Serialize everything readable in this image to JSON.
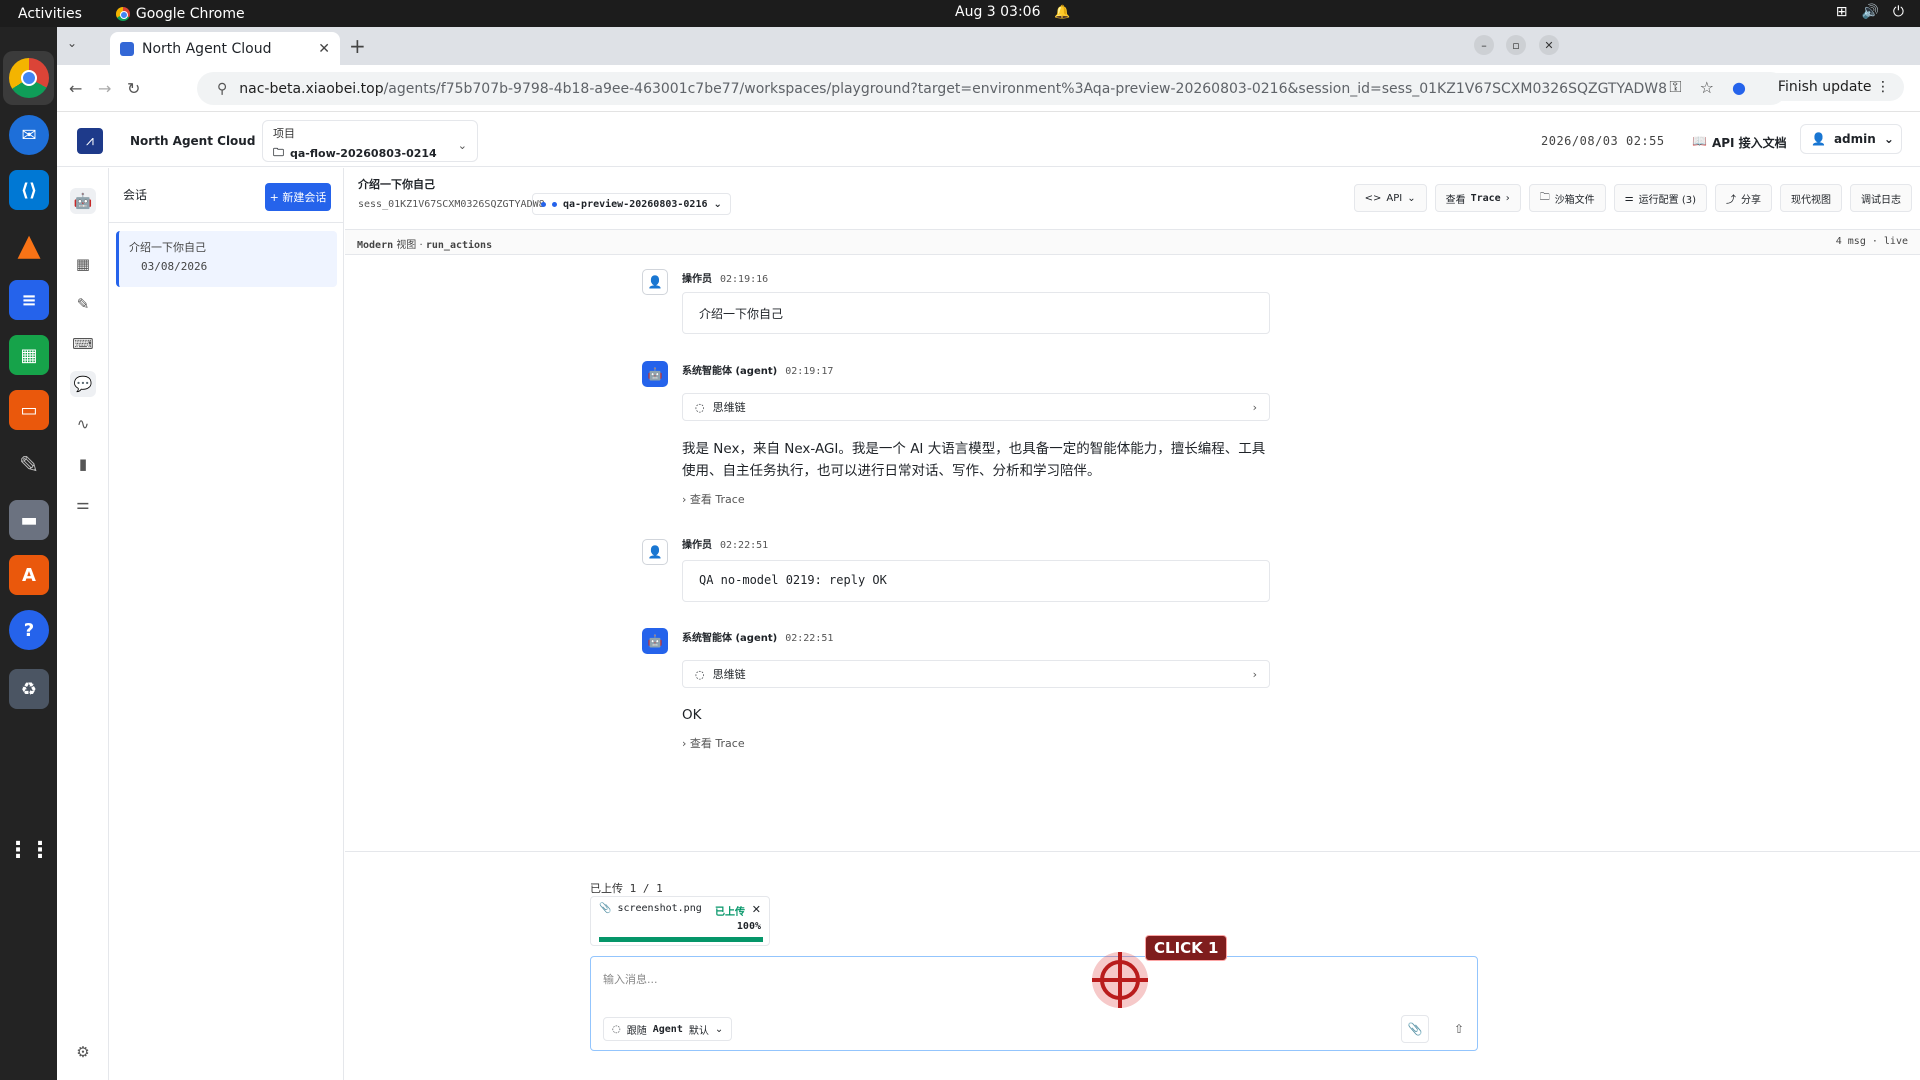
{
  "os": {
    "activities": "Activities",
    "app_name": "Google Chrome",
    "clock": "Aug 3  03:06"
  },
  "browser": {
    "tab_title": "North Agent Cloud",
    "url_host": "nac-beta.xiaobei.top",
    "url_path": "/agents/f75b707b-9798-4b18-a9ee-463001c7be77/workspaces/playground?target=environment%3Aqa-preview-20260803-0216&session_id=sess_01KZ1V67SCXM0326SQZGTYADW8",
    "finish_update": "Finish update"
  },
  "app": {
    "brand": "North Agent Cloud",
    "project_label": "项目",
    "project_value": "qa-flow-20260803-0214",
    "datetime": "2026/08/03 02:55",
    "api_docs": "API 接入文档",
    "user": "admin"
  },
  "sessions": {
    "title": "会话",
    "new_button": "+ 新建会话",
    "items": [
      {
        "title": "介绍一下你自己",
        "date": "03/08/2026"
      }
    ]
  },
  "session_header": {
    "title": "介绍一下你自己",
    "id": "sess_01KZ1V67SCXM0326SQZGTYADW8",
    "environment": "qa-preview-20260803-0216",
    "buttons": {
      "api": "API",
      "trace_prefix": "查看",
      "trace": "Trace",
      "sandbox": "沙箱文件",
      "run_config": "运行配置 (3)",
      "share": "分享",
      "modern_view": "现代视图",
      "debug_log": "调试日志"
    }
  },
  "subbar": {
    "left_mode": "Modern",
    "left_view": "视图",
    "left_sep": "·",
    "left_action": "run_actions",
    "right": "4 msg · live"
  },
  "messages": [
    {
      "role": "user",
      "author": "操作员",
      "time": "02:19:16",
      "text": "介绍一下你自己"
    },
    {
      "role": "agent",
      "author": "系统智能体 (agent)",
      "time": "02:19:17",
      "thinking": "思维链",
      "text": "我是 Nex，来自 Nex-AGI。我是一个 AI 大语言模型，也具备一定的智能体能力，擅长编程、工具使用、自主任务执行，也可以进行日常对话、写作、分析和学习陪伴。",
      "trace": "查看 Trace"
    },
    {
      "role": "user",
      "author": "操作员",
      "time": "02:22:51",
      "text": "QA no-model 0219: reply OK"
    },
    {
      "role": "agent",
      "author": "系统智能体 (agent)",
      "time": "02:22:51",
      "thinking": "思维链",
      "text": "OK",
      "trace": "查看 Trace"
    }
  ],
  "composer": {
    "uploaded_label": "已上传 1 / 1",
    "file_name": "screenshot.png",
    "file_status": "已上传",
    "file_progress_label": "100%",
    "file_progress": 1.0,
    "placeholder": "输入消息...",
    "follow_prefix": "跟随",
    "follow_agent": "Agent",
    "follow_default": "默认"
  },
  "overlay": {
    "click_label": "CLICK 1"
  }
}
